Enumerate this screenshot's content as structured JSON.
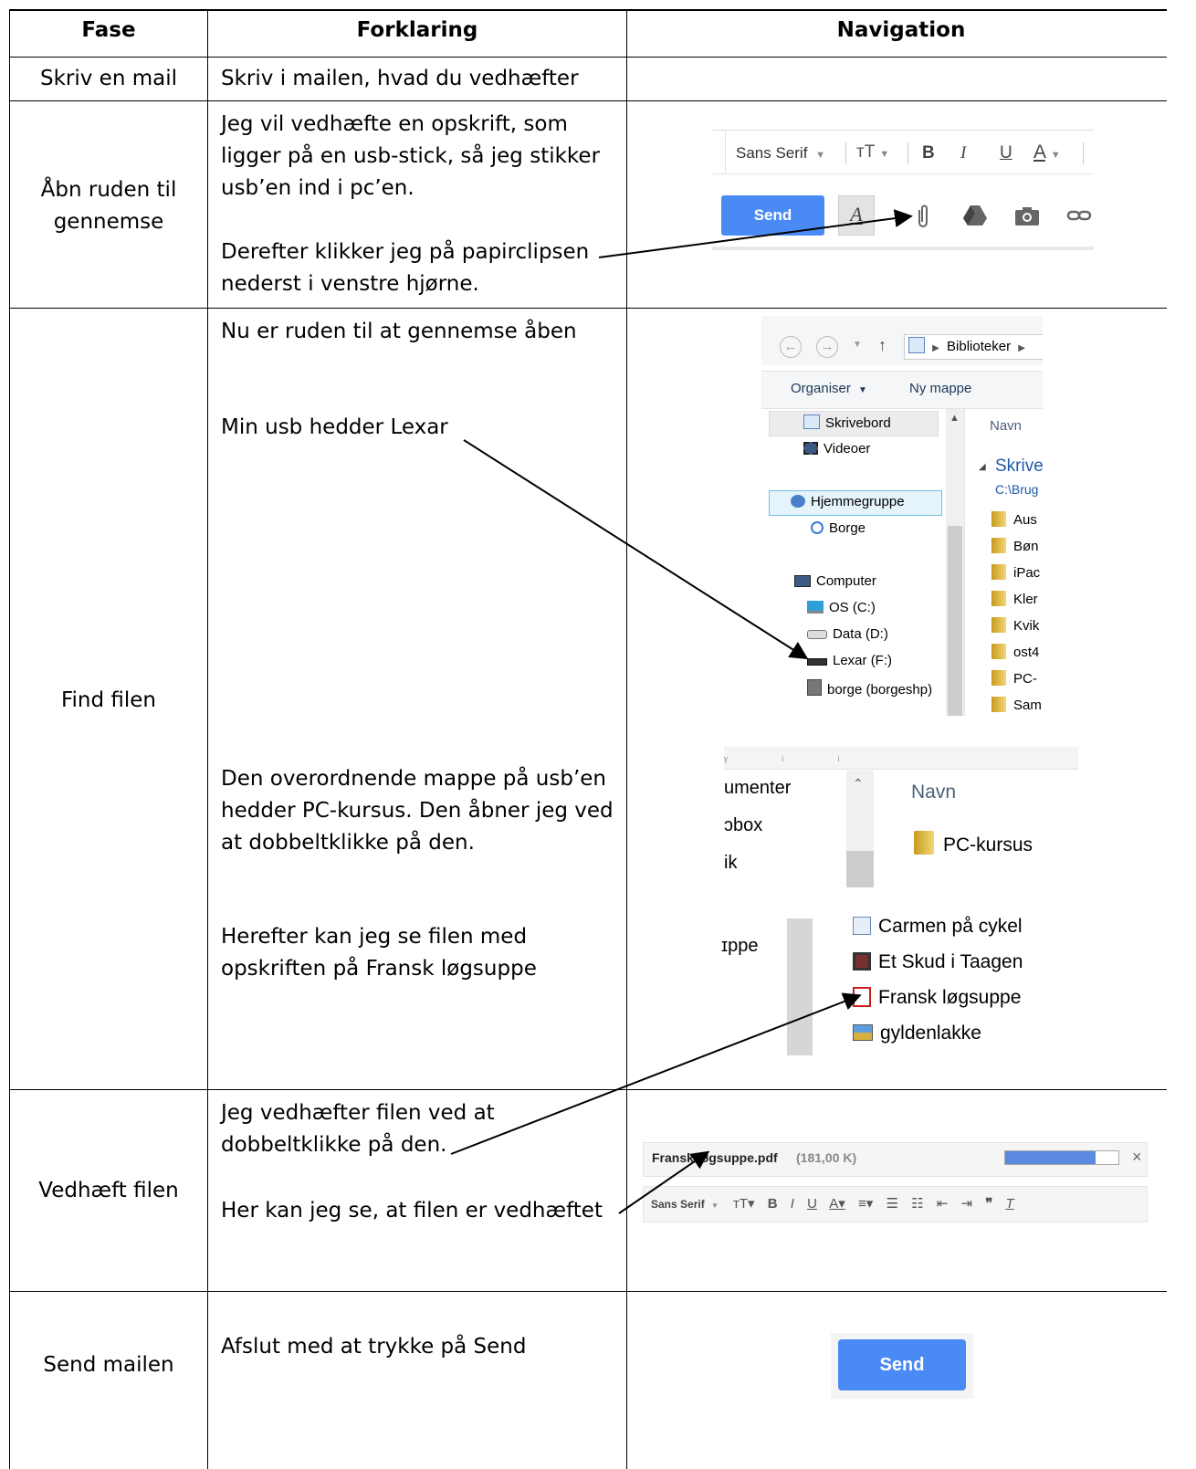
{
  "table": {
    "headers": [
      "Fase",
      "Forklaring",
      "Navigation"
    ],
    "rows": [
      {
        "phase": "Skriv en mail",
        "explanation": [
          "Skriv i mailen, hvad du vedhæfter"
        ]
      },
      {
        "phase": [
          "Åbn ruden til",
          "gennemse"
        ],
        "explanation": [
          "Jeg vil vedhæfte en opskrift, som",
          "ligger på en usb-stick, så jeg stikker",
          "usb’en ind i pc’en."
        ],
        "explanation2": [
          "Derefter klikker jeg på papirclipsen",
          "nederst i venstre hjørne."
        ]
      },
      {
        "phase": "Find filen",
        "p1": "Nu er ruden til at gennemse åben",
        "p2": "Min usb hedder Lexar",
        "p3": [
          "Den overordnende mappe på usb’en",
          "hedder PC-kursus. Den åbner jeg ved",
          "at dobbeltklikke på den."
        ],
        "p4": [
          "Herefter kan jeg se filen med",
          "opskriften på Fransk løgsuppe"
        ]
      },
      {
        "phase": "Vedhæft filen",
        "p1": [
          "Jeg vedhæfter filen ved at",
          "dobbeltklikke på den."
        ],
        "p2": "Her kan jeg se, at filen er vedhæftet"
      },
      {
        "phase": "Send mailen",
        "p1": "Afslut med at trykke på Send"
      }
    ]
  },
  "gmail_toolbar": {
    "font": "Sans Serif",
    "size_icon": "ᴛT",
    "bold": "B",
    "italic": "I",
    "underline": "U",
    "textcolor": "A",
    "send": "Send",
    "format_icon": "A"
  },
  "explorer": {
    "nav": {
      "path": "Biblioteker"
    },
    "toolbar": {
      "organize": "Organiser",
      "new_folder": "Ny mappe"
    },
    "column_name": "Navn",
    "tree": [
      "Skrivebord",
      "Videoer",
      "Hjemmegruppe",
      "Borge",
      "Computer",
      "OS (C:)",
      "Data (D:)",
      "Lexar (F:)",
      "borge (borgeshp)"
    ],
    "group_title": "Skrive",
    "group_path": "C:\\Brug",
    "folders": [
      "Aus",
      "Bøn",
      "iPac",
      "Kler",
      "Kvik",
      "ost4",
      "PC-",
      "Sam"
    ]
  },
  "explorer2": {
    "left_items": [
      "umenter",
      "ɔbox",
      "ik"
    ],
    "column_name": "Navn",
    "folder": "PC-kursus"
  },
  "explorer3": {
    "left_item": "ɪppe",
    "files": [
      "Carmen på cykel",
      "Et Skud i Taagen",
      "Fransk løgsuppe",
      "gyldenlakke"
    ]
  },
  "attachment": {
    "filename": "Fransk løgsuppe.pdf",
    "size": "(181,00 K)",
    "progress": 0.8,
    "close": "×",
    "toolbar_font": "Sans Serif"
  },
  "send_button": "Send"
}
